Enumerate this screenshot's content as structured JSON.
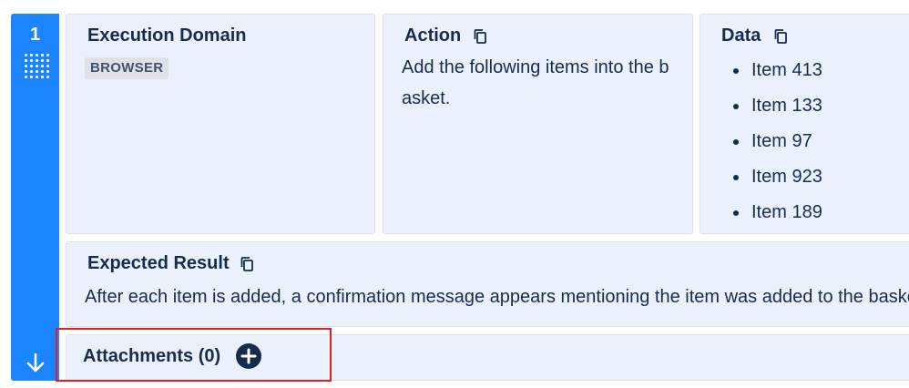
{
  "step": {
    "number": "1"
  },
  "execution_domain": {
    "title": "Execution Domain",
    "badge": "BROWSER"
  },
  "action": {
    "title": "Action",
    "text": "Add the following items into the basket."
  },
  "data": {
    "title": "Data",
    "items": [
      "Item 413",
      "Item 133",
      "Item 97",
      "Item 923",
      "Item 189"
    ]
  },
  "expected_result": {
    "title": "Expected Result",
    "text": "After each item is added, a confirmation message appears mentioning the item was added to the basket."
  },
  "attachments": {
    "label": "Attachments (0)"
  },
  "colors": {
    "rail": "#1a85ff",
    "card_bg": "#eaf1fd",
    "text": "#172b4d",
    "badge_bg": "#dfe1e6",
    "highlight": "#e02020"
  },
  "icons": {
    "drag": "drag-handle-icon",
    "copy": "copy-icon",
    "move_down": "arrow-down-icon",
    "add": "plus-circle-icon"
  }
}
